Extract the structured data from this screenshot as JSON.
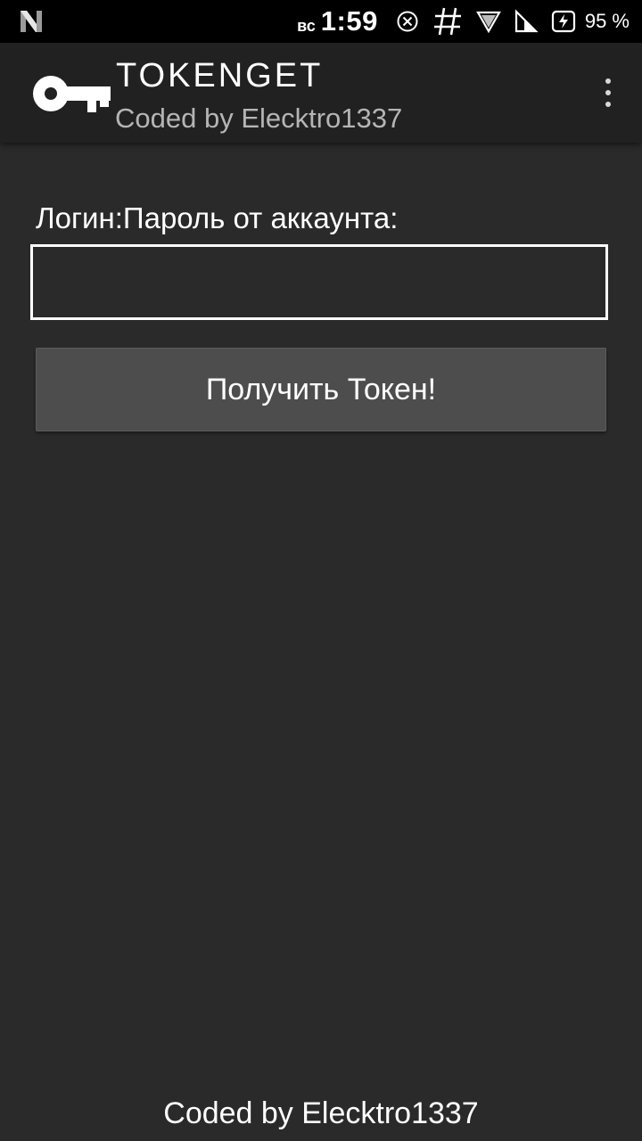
{
  "status_bar": {
    "day": "вс",
    "time": "1:59",
    "battery_percent": "95 %",
    "icons": [
      "n-logo-icon",
      "dnd-icon",
      "hashtag-icon",
      "wifi-icon",
      "signal-icon",
      "battery-charging-icon"
    ]
  },
  "app_bar": {
    "title": "TOKENGET",
    "subtitle": "Coded by Elecktro1337",
    "logo_icon": "key-icon",
    "menu_icon": "more-vert-icon"
  },
  "form": {
    "label": "Логин:Пароль от аккаунта:",
    "input_value": "",
    "input_placeholder": "",
    "button_label": "Получить Токен!"
  },
  "footer": {
    "credit": "Coded by Elecktro1337"
  },
  "colors": {
    "background": "#2a2a2a",
    "app_bar": "#212121",
    "status_bar": "#000000",
    "button": "#4d4d4d",
    "text": "#ffffff",
    "subtitle": "#b5b5b5"
  }
}
